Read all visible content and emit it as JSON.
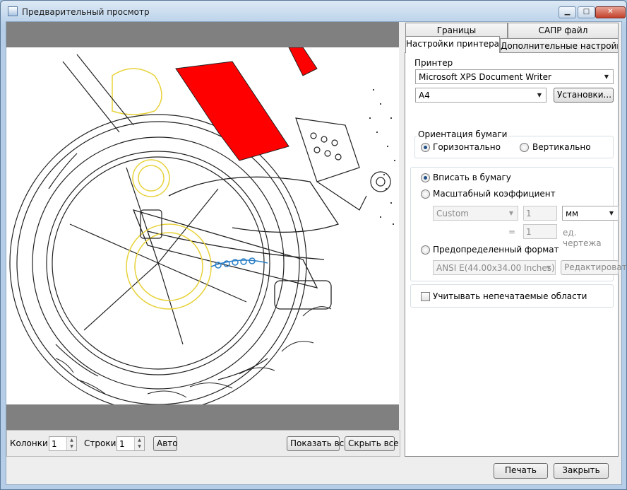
{
  "window": {
    "title": "Предварительный просмотр",
    "buttons": {
      "minimize": "▁",
      "maximize": "□",
      "close": "✕"
    }
  },
  "bottom_bar": {
    "columns_label": "Колонки:",
    "columns_value": "1",
    "rows_label": "Строки:",
    "rows_value": "1",
    "auto_button": "Авто",
    "show_all_button": "Показать все",
    "hide_all_button": "Скрыть все"
  },
  "tabs": {
    "row1": [
      "Границы",
      "САПР файл"
    ],
    "row2": [
      "Настройки принтера",
      "Дополнительные настройки"
    ],
    "active": "Настройки принтера"
  },
  "printer": {
    "group_title": "Принтер",
    "printer_name": "Microsoft XPS Document Writer",
    "paper_size": "A4",
    "setup_button": "Установки..."
  },
  "orientation": {
    "group_title": "Ориентация бумаги",
    "landscape": "Горизонтально",
    "portrait": "Вертикально",
    "selected": "landscape"
  },
  "scaling": {
    "fit_to_paper": "Вписать в бумагу",
    "scale_factor": "Масштабный коэффициент",
    "scale_preset": "Custom",
    "scale_value": "1",
    "units": "мм",
    "equals": "=",
    "drawing_value": "1",
    "drawing_units": "ед. чертежа",
    "predefined_format": "Предопределенный формат",
    "format_value": "ANSI E(44.00x34.00 Inches)",
    "edit_button": "Редактировать",
    "selected": "fit_to_paper"
  },
  "nonprintable": {
    "label": "Учитывать непечатаемые области",
    "checked": false
  },
  "footer": {
    "print_button": "Печать",
    "close_button": "Закрыть"
  },
  "colors": {
    "drawing_red": "#ff0000",
    "drawing_yellow": "#e8d23a",
    "drawing_blue": "#2a7fc7",
    "preview_gray": "#808080"
  }
}
